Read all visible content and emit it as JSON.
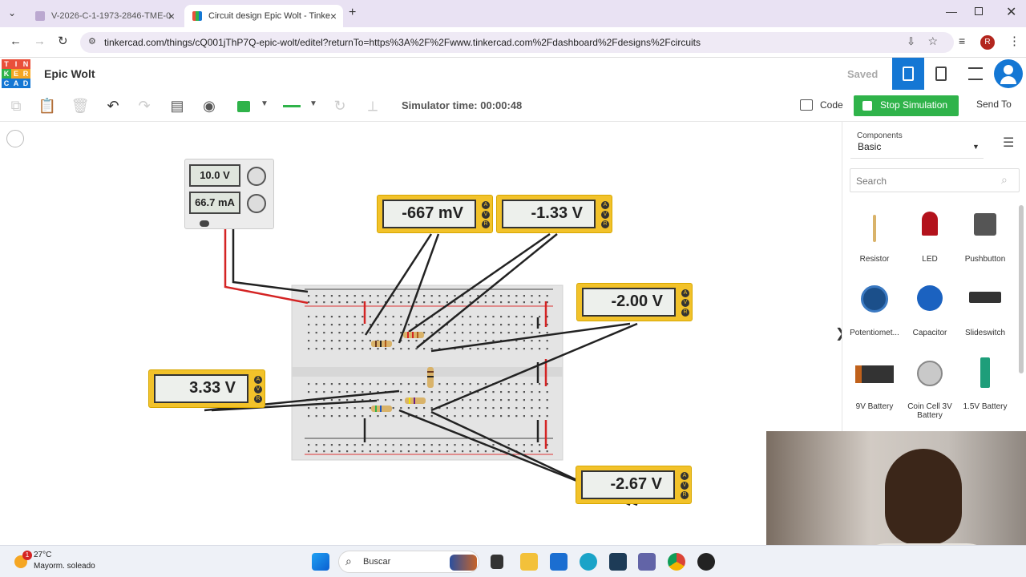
{
  "browser": {
    "tabs": [
      {
        "title": "V-2026-C-1-1973-2846-TME-0",
        "active": false
      },
      {
        "title": "Circuit design Epic Wolt - Tinke",
        "active": true
      }
    ],
    "url": "tinkercad.com/things/cQ001jThP7Q-epic-wolt/editel?returnTo=https%3A%2F%2Fwww.tinkercad.com%2Fdashboard%2Fdesigns%2Fcircuits",
    "profile_initial": "R"
  },
  "app": {
    "logo_letters": [
      "T",
      "I",
      "N",
      "K",
      "E",
      "R",
      "C",
      "A",
      "D"
    ],
    "design_name": "Epic Wolt",
    "save_status": "Saved",
    "simulator_time": "Simulator time: 00:00:48",
    "code_label": "Code",
    "stop_label": "Stop Simulation",
    "send_to_label": "Send To"
  },
  "power_supply": {
    "voltage": "10.0 V",
    "current": "66.7 mA"
  },
  "meters": {
    "m1": "-667 mV",
    "m2": "-1.33 V",
    "m3": "-2.00 V",
    "m4": "3.33 V",
    "m5": "-2.67 V"
  },
  "panel": {
    "components_label": "Components",
    "category": "Basic",
    "search_placeholder": "Search",
    "items": [
      {
        "label": "Resistor"
      },
      {
        "label": "LED"
      },
      {
        "label": "Pushbutton"
      },
      {
        "label": "Potentiomet..."
      },
      {
        "label": "Capacitor"
      },
      {
        "label": "Slideswitch"
      },
      {
        "label": "9V Battery"
      },
      {
        "label": "Coin Cell 3V Battery"
      },
      {
        "label": "1.5V Battery"
      }
    ]
  },
  "taskbar": {
    "weather_temp": "27°C",
    "weather_desc": "Mayorm. soleado",
    "weather_badge": "1",
    "search_label": "Buscar"
  },
  "colors": {
    "accent_blue": "#1477d4",
    "stop_green": "#2fb34a",
    "meter_yellow": "#f2c22a"
  }
}
